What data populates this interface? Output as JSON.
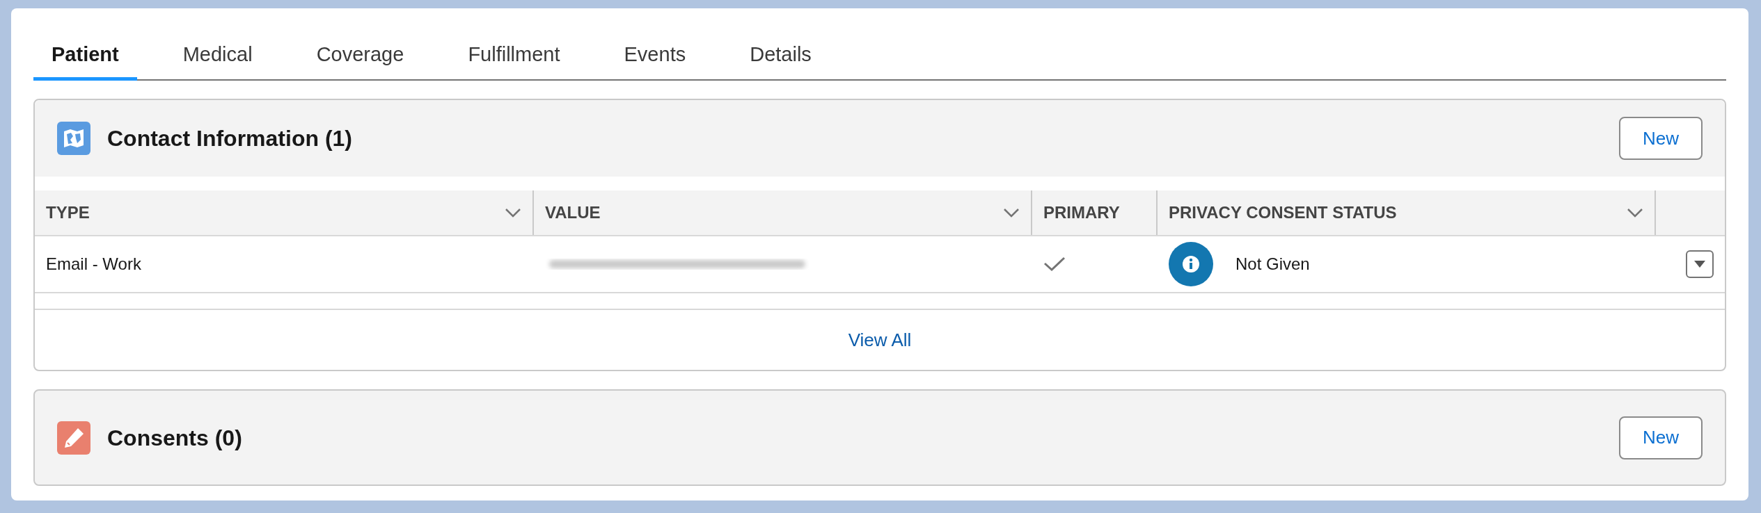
{
  "tabs": [
    {
      "label": "Patient",
      "selected": true
    },
    {
      "label": "Medical",
      "selected": false
    },
    {
      "label": "Coverage",
      "selected": false
    },
    {
      "label": "Fulfillment",
      "selected": false
    },
    {
      "label": "Events",
      "selected": false
    },
    {
      "label": "Details",
      "selected": false
    }
  ],
  "sections": [
    {
      "kind": "contacts",
      "title": "Contact Information (1)",
      "new_button": "New",
      "table": {
        "columns": [
          {
            "label": "TYPE",
            "sortable": true
          },
          {
            "label": "VALUE",
            "sortable": true
          },
          {
            "label": "PRIMARY",
            "sortable": false
          },
          {
            "label": "PRIVACY CONSENT STATUS",
            "sortable": true
          }
        ],
        "rows": [
          {
            "type": "Email - Work",
            "value_redacted": true,
            "primary": true,
            "consent_status": "Not Given"
          }
        ]
      },
      "view_all": "View All"
    },
    {
      "kind": "consents",
      "title": "Consents (0)",
      "new_button": "New"
    }
  ]
}
